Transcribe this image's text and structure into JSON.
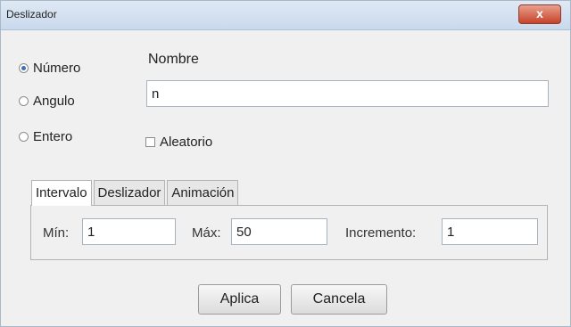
{
  "window": {
    "title": "Deslizador",
    "close_label": "x"
  },
  "type_options": [
    {
      "label": "Número",
      "selected": true
    },
    {
      "label": "Angulo",
      "selected": false
    },
    {
      "label": "Entero",
      "selected": false
    }
  ],
  "name": {
    "label": "Nombre",
    "value": "n"
  },
  "random": {
    "label": "Aleatorio",
    "checked": false
  },
  "tabs": [
    {
      "label": "Intervalo",
      "active": true
    },
    {
      "label": "Deslizador",
      "active": false
    },
    {
      "label": "Animación",
      "active": false
    }
  ],
  "interval": {
    "min_label": "Mín:",
    "min_value": "1",
    "max_label": "Máx:",
    "max_value": "50",
    "increment_label": "Incremento:",
    "increment_value": "1"
  },
  "buttons": {
    "apply": "Aplica",
    "cancel": "Cancela"
  },
  "colors": {
    "radio_selected": "#3c6fb3",
    "close_button": "#c7422b"
  }
}
